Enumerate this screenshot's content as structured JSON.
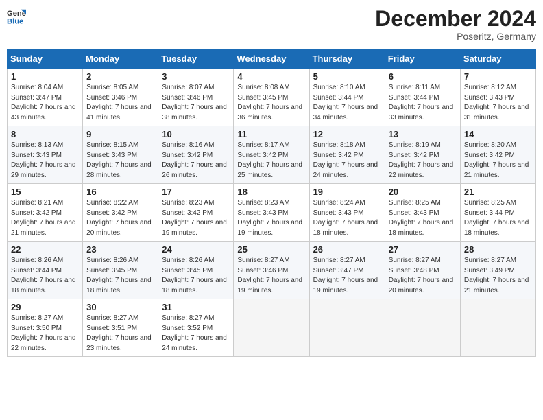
{
  "header": {
    "logo_general": "General",
    "logo_blue": "Blue",
    "month_title": "December 2024",
    "location": "Poseritz, Germany"
  },
  "weekdays": [
    "Sunday",
    "Monday",
    "Tuesday",
    "Wednesday",
    "Thursday",
    "Friday",
    "Saturday"
  ],
  "weeks": [
    [
      {
        "day": "1",
        "sunrise": "Sunrise: 8:04 AM",
        "sunset": "Sunset: 3:47 PM",
        "daylight": "Daylight: 7 hours and 43 minutes."
      },
      {
        "day": "2",
        "sunrise": "Sunrise: 8:05 AM",
        "sunset": "Sunset: 3:46 PM",
        "daylight": "Daylight: 7 hours and 41 minutes."
      },
      {
        "day": "3",
        "sunrise": "Sunrise: 8:07 AM",
        "sunset": "Sunset: 3:46 PM",
        "daylight": "Daylight: 7 hours and 38 minutes."
      },
      {
        "day": "4",
        "sunrise": "Sunrise: 8:08 AM",
        "sunset": "Sunset: 3:45 PM",
        "daylight": "Daylight: 7 hours and 36 minutes."
      },
      {
        "day": "5",
        "sunrise": "Sunrise: 8:10 AM",
        "sunset": "Sunset: 3:44 PM",
        "daylight": "Daylight: 7 hours and 34 minutes."
      },
      {
        "day": "6",
        "sunrise": "Sunrise: 8:11 AM",
        "sunset": "Sunset: 3:44 PM",
        "daylight": "Daylight: 7 hours and 33 minutes."
      },
      {
        "day": "7",
        "sunrise": "Sunrise: 8:12 AM",
        "sunset": "Sunset: 3:43 PM",
        "daylight": "Daylight: 7 hours and 31 minutes."
      }
    ],
    [
      {
        "day": "8",
        "sunrise": "Sunrise: 8:13 AM",
        "sunset": "Sunset: 3:43 PM",
        "daylight": "Daylight: 7 hours and 29 minutes."
      },
      {
        "day": "9",
        "sunrise": "Sunrise: 8:15 AM",
        "sunset": "Sunset: 3:43 PM",
        "daylight": "Daylight: 7 hours and 28 minutes."
      },
      {
        "day": "10",
        "sunrise": "Sunrise: 8:16 AM",
        "sunset": "Sunset: 3:42 PM",
        "daylight": "Daylight: 7 hours and 26 minutes."
      },
      {
        "day": "11",
        "sunrise": "Sunrise: 8:17 AM",
        "sunset": "Sunset: 3:42 PM",
        "daylight": "Daylight: 7 hours and 25 minutes."
      },
      {
        "day": "12",
        "sunrise": "Sunrise: 8:18 AM",
        "sunset": "Sunset: 3:42 PM",
        "daylight": "Daylight: 7 hours and 24 minutes."
      },
      {
        "day": "13",
        "sunrise": "Sunrise: 8:19 AM",
        "sunset": "Sunset: 3:42 PM",
        "daylight": "Daylight: 7 hours and 22 minutes."
      },
      {
        "day": "14",
        "sunrise": "Sunrise: 8:20 AM",
        "sunset": "Sunset: 3:42 PM",
        "daylight": "Daylight: 7 hours and 21 minutes."
      }
    ],
    [
      {
        "day": "15",
        "sunrise": "Sunrise: 8:21 AM",
        "sunset": "Sunset: 3:42 PM",
        "daylight": "Daylight: 7 hours and 21 minutes."
      },
      {
        "day": "16",
        "sunrise": "Sunrise: 8:22 AM",
        "sunset": "Sunset: 3:42 PM",
        "daylight": "Daylight: 7 hours and 20 minutes."
      },
      {
        "day": "17",
        "sunrise": "Sunrise: 8:23 AM",
        "sunset": "Sunset: 3:42 PM",
        "daylight": "Daylight: 7 hours and 19 minutes."
      },
      {
        "day": "18",
        "sunrise": "Sunrise: 8:23 AM",
        "sunset": "Sunset: 3:43 PM",
        "daylight": "Daylight: 7 hours and 19 minutes."
      },
      {
        "day": "19",
        "sunrise": "Sunrise: 8:24 AM",
        "sunset": "Sunset: 3:43 PM",
        "daylight": "Daylight: 7 hours and 18 minutes."
      },
      {
        "day": "20",
        "sunrise": "Sunrise: 8:25 AM",
        "sunset": "Sunset: 3:43 PM",
        "daylight": "Daylight: 7 hours and 18 minutes."
      },
      {
        "day": "21",
        "sunrise": "Sunrise: 8:25 AM",
        "sunset": "Sunset: 3:44 PM",
        "daylight": "Daylight: 7 hours and 18 minutes."
      }
    ],
    [
      {
        "day": "22",
        "sunrise": "Sunrise: 8:26 AM",
        "sunset": "Sunset: 3:44 PM",
        "daylight": "Daylight: 7 hours and 18 minutes."
      },
      {
        "day": "23",
        "sunrise": "Sunrise: 8:26 AM",
        "sunset": "Sunset: 3:45 PM",
        "daylight": "Daylight: 7 hours and 18 minutes."
      },
      {
        "day": "24",
        "sunrise": "Sunrise: 8:26 AM",
        "sunset": "Sunset: 3:45 PM",
        "daylight": "Daylight: 7 hours and 18 minutes."
      },
      {
        "day": "25",
        "sunrise": "Sunrise: 8:27 AM",
        "sunset": "Sunset: 3:46 PM",
        "daylight": "Daylight: 7 hours and 19 minutes."
      },
      {
        "day": "26",
        "sunrise": "Sunrise: 8:27 AM",
        "sunset": "Sunset: 3:47 PM",
        "daylight": "Daylight: 7 hours and 19 minutes."
      },
      {
        "day": "27",
        "sunrise": "Sunrise: 8:27 AM",
        "sunset": "Sunset: 3:48 PM",
        "daylight": "Daylight: 7 hours and 20 minutes."
      },
      {
        "day": "28",
        "sunrise": "Sunrise: 8:27 AM",
        "sunset": "Sunset: 3:49 PM",
        "daylight": "Daylight: 7 hours and 21 minutes."
      }
    ],
    [
      {
        "day": "29",
        "sunrise": "Sunrise: 8:27 AM",
        "sunset": "Sunset: 3:50 PM",
        "daylight": "Daylight: 7 hours and 22 minutes."
      },
      {
        "day": "30",
        "sunrise": "Sunrise: 8:27 AM",
        "sunset": "Sunset: 3:51 PM",
        "daylight": "Daylight: 7 hours and 23 minutes."
      },
      {
        "day": "31",
        "sunrise": "Sunrise: 8:27 AM",
        "sunset": "Sunset: 3:52 PM",
        "daylight": "Daylight: 7 hours and 24 minutes."
      },
      null,
      null,
      null,
      null
    ]
  ]
}
